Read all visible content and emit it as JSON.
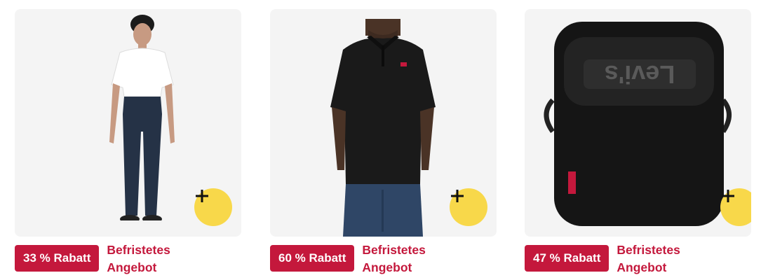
{
  "products": [
    {
      "image": "chino-pants-white-tee-model",
      "discount": "33 % Rabatt",
      "deal_line1": "Befristetes",
      "deal_line2": "Angebot",
      "add_icon": "plus-icon"
    },
    {
      "image": "black-polo-shirt-model",
      "discount": "60 % Rabatt",
      "deal_line1": "Befristetes",
      "deal_line2": "Angebot",
      "add_icon": "plus-icon"
    },
    {
      "image": "black-crossbody-bag",
      "bag_logo": "Levi's",
      "discount": "47 % Rabatt",
      "deal_line1": "Befristetes",
      "deal_line2": "Angebot",
      "add_icon": "plus-icon"
    }
  ],
  "colors": {
    "badge": "#c4183c",
    "add_button": "#f8d84a",
    "image_background": "#f4f4f4"
  }
}
